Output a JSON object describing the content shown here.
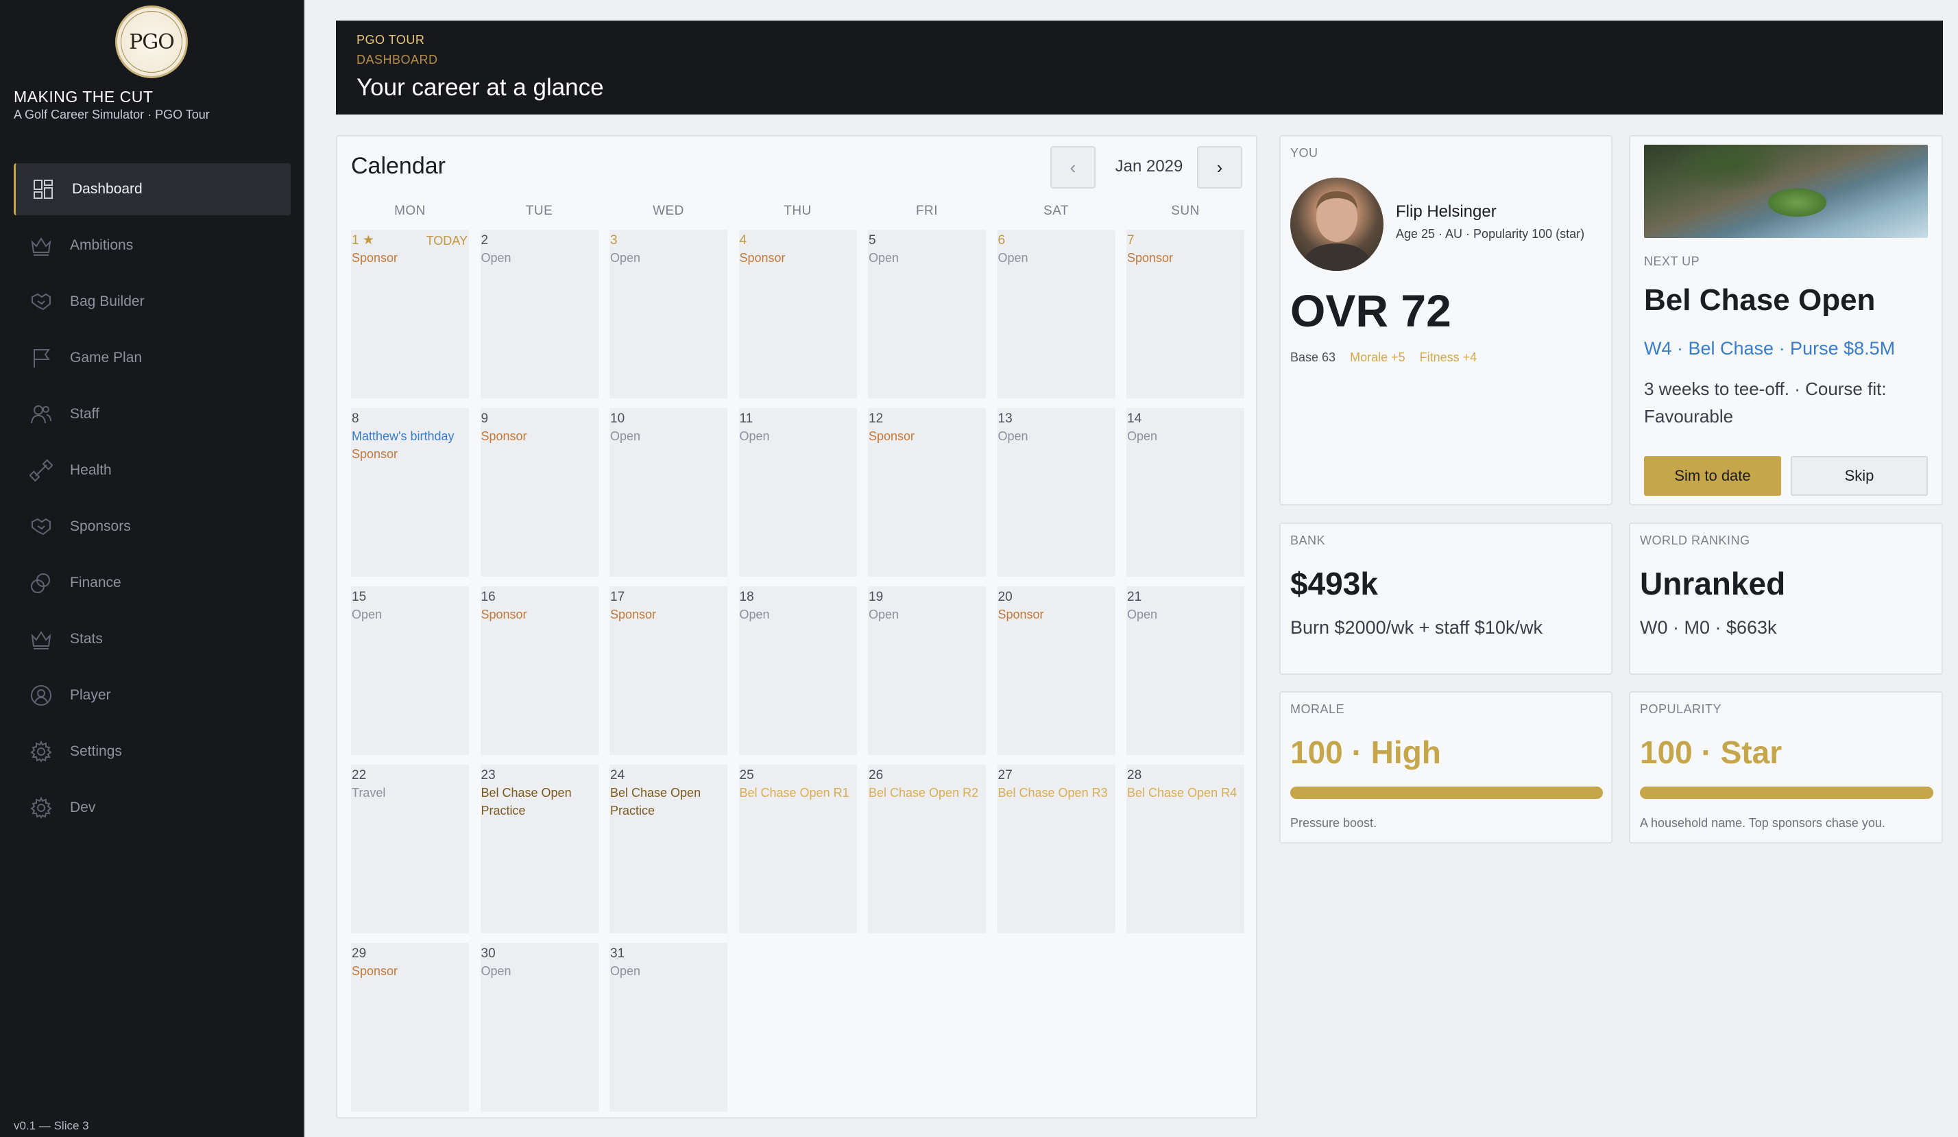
{
  "app": {
    "logo_text": "PGO",
    "title": "MAKING THE CUT",
    "subtitle": "A Golf Career Simulator · PGO Tour",
    "version": "v0.1 — Slice 3"
  },
  "sidebar": {
    "items": [
      {
        "label": "Dashboard",
        "icon": "dashboard-icon",
        "active": true
      },
      {
        "label": "Ambitions",
        "icon": "crown-icon"
      },
      {
        "label": "Bag Builder",
        "icon": "handshake-icon"
      },
      {
        "label": "Game Plan",
        "icon": "flag-icon"
      },
      {
        "label": "Staff",
        "icon": "users-icon"
      },
      {
        "label": "Health",
        "icon": "dumbbell-icon"
      },
      {
        "label": "Sponsors",
        "icon": "handshake-icon"
      },
      {
        "label": "Finance",
        "icon": "coins-icon"
      },
      {
        "label": "Stats",
        "icon": "crown-icon"
      },
      {
        "label": "Player",
        "icon": "user-circle-icon"
      },
      {
        "label": "Settings",
        "icon": "gear-icon"
      },
      {
        "label": "Dev",
        "icon": "gear-icon"
      }
    ]
  },
  "header": {
    "eyebrow": "PGO TOUR",
    "breadcrumb": "DASHBOARD",
    "title": "Your career at a glance"
  },
  "calendar": {
    "title": "Calendar",
    "month": "Jan 2029",
    "prev_label": "‹",
    "next_label": "›",
    "weekdays": [
      "MON",
      "TUE",
      "WED",
      "THU",
      "FRI",
      "SAT",
      "SUN"
    ],
    "today_label": "TODAY",
    "days": [
      {
        "num": "1 ★",
        "today": true,
        "events": [
          {
            "text": "Sponsor",
            "kind": "sponsor"
          }
        ]
      },
      {
        "num": "2",
        "events": [
          {
            "text": "Open",
            "kind": "open"
          }
        ]
      },
      {
        "num": "3",
        "events": [
          {
            "text": "Open",
            "kind": "open"
          }
        ]
      },
      {
        "num": "4",
        "events": [
          {
            "text": "Sponsor",
            "kind": "sponsor"
          }
        ]
      },
      {
        "num": "5",
        "events": [
          {
            "text": "Open",
            "kind": "open"
          }
        ]
      },
      {
        "num": "6",
        "events": [
          {
            "text": "Open",
            "kind": "open"
          }
        ]
      },
      {
        "num": "7",
        "events": [
          {
            "text": "Sponsor",
            "kind": "sponsor"
          }
        ]
      },
      {
        "num": "8",
        "events": [
          {
            "text": "Matthew's birthday",
            "kind": "birthday"
          },
          {
            "text": "Sponsor",
            "kind": "sponsor"
          }
        ]
      },
      {
        "num": "9",
        "events": [
          {
            "text": "Sponsor",
            "kind": "sponsor"
          }
        ]
      },
      {
        "num": "10",
        "events": [
          {
            "text": "Open",
            "kind": "open"
          }
        ]
      },
      {
        "num": "11",
        "events": [
          {
            "text": "Open",
            "kind": "open"
          }
        ]
      },
      {
        "num": "12",
        "events": [
          {
            "text": "Sponsor",
            "kind": "sponsor"
          }
        ]
      },
      {
        "num": "13",
        "events": [
          {
            "text": "Open",
            "kind": "open"
          }
        ]
      },
      {
        "num": "14",
        "events": [
          {
            "text": "Open",
            "kind": "open"
          }
        ]
      },
      {
        "num": "15",
        "events": [
          {
            "text": "Open",
            "kind": "open"
          }
        ]
      },
      {
        "num": "16",
        "events": [
          {
            "text": "Sponsor",
            "kind": "sponsor"
          }
        ]
      },
      {
        "num": "17",
        "events": [
          {
            "text": "Sponsor",
            "kind": "sponsor"
          }
        ]
      },
      {
        "num": "18",
        "events": [
          {
            "text": "Open",
            "kind": "open"
          }
        ]
      },
      {
        "num": "19",
        "events": [
          {
            "text": "Open",
            "kind": "open"
          }
        ]
      },
      {
        "num": "20",
        "events": [
          {
            "text": "Sponsor",
            "kind": "sponsor"
          }
        ]
      },
      {
        "num": "21",
        "events": [
          {
            "text": "Open",
            "kind": "open"
          }
        ]
      },
      {
        "num": "22",
        "events": [
          {
            "text": "Travel",
            "kind": "travel"
          }
        ]
      },
      {
        "num": "23",
        "events": [
          {
            "text": "Bel Chase Open Practice",
            "kind": "practice"
          }
        ]
      },
      {
        "num": "24",
        "events": [
          {
            "text": "Bel Chase Open Practice",
            "kind": "practice"
          }
        ]
      },
      {
        "num": "25",
        "events": [
          {
            "text": "Bel Chase Open R1",
            "kind": "round"
          }
        ]
      },
      {
        "num": "26",
        "events": [
          {
            "text": "Bel Chase Open R2",
            "kind": "round"
          }
        ]
      },
      {
        "num": "27",
        "events": [
          {
            "text": "Bel Chase Open R3",
            "kind": "round"
          }
        ]
      },
      {
        "num": "28",
        "events": [
          {
            "text": "Bel Chase Open R4",
            "kind": "round"
          }
        ]
      },
      {
        "num": "29",
        "events": [
          {
            "text": "Sponsor",
            "kind": "sponsor"
          }
        ]
      },
      {
        "num": "30",
        "events": [
          {
            "text": "Open",
            "kind": "open"
          }
        ]
      },
      {
        "num": "31",
        "events": [
          {
            "text": "Open",
            "kind": "open"
          }
        ]
      }
    ]
  },
  "player": {
    "eyebrow": "YOU",
    "name": "Flip Helsinger",
    "meta": "Age 25 · AU · Popularity 100 (star)",
    "ovr": "OVR 72",
    "base": "Base 63",
    "morale": "Morale +5",
    "fitness": "Fitness +4"
  },
  "next_up": {
    "label": "NEXT UP",
    "title": "Bel Chase Open",
    "subtitle": "W4 · Bel Chase · Purse $8.5M",
    "description": "3 weeks to tee-off.  ·  Course fit: Favourable",
    "primary_button": "Sim to date",
    "secondary_button": "Skip"
  },
  "bank": {
    "label": "BANK",
    "value": "$493k",
    "detail": "Burn $2000/wk + staff $10k/wk"
  },
  "ranking": {
    "label": "WORLD RANKING",
    "value": "Unranked",
    "detail": "W0 · M0 · $663k"
  },
  "morale": {
    "label": "MORALE",
    "value": "100 · High",
    "level": 100,
    "note": "Pressure boost."
  },
  "popularity": {
    "label": "POPULARITY",
    "value": "100 · Star",
    "level": 100,
    "note": "A household name. Top sponsors chase you."
  },
  "colors": {
    "accent_gold": "#c5a64a",
    "sidebar_bg": "#16181c",
    "link_blue": "#3a7dc9",
    "sponsor_orange": "#c07a3c"
  }
}
